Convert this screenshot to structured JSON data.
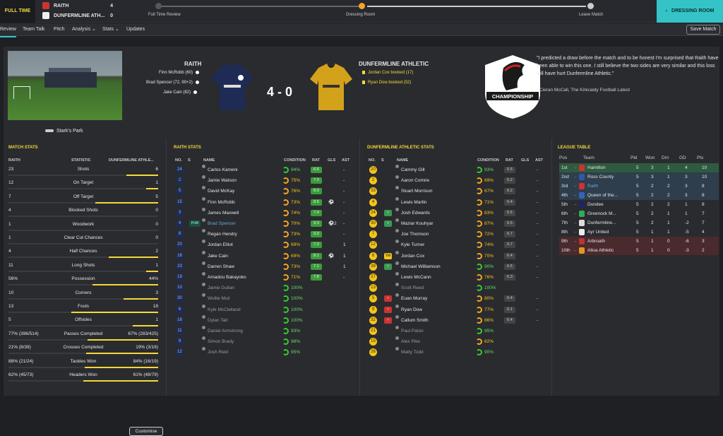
{
  "topbar": {
    "status": "FULL TIME",
    "home": {
      "name": "RAITH",
      "score": "4"
    },
    "away": {
      "name": "DUNFERMLINE ATH...",
      "score": "0"
    },
    "stages": [
      "Full Time Review",
      "Dressing Room",
      "Leave Match"
    ],
    "current_stage": "DRESSING ROOM"
  },
  "nav": {
    "items": [
      "Review",
      "Team Talk",
      "Pitch",
      "Analysis ⌄",
      "Stats ⌄",
      "Updates"
    ],
    "save": "Save Match"
  },
  "match": {
    "stadium": "Stark's Park",
    "home_team": "RAITH",
    "away_team": "DUNFERMLINE ATHLETIC",
    "score": "4 - 0",
    "home_events": [
      "Finn McRobb (60)",
      "Brad Spencer (72, 90+2)",
      "Jake Cain (82)"
    ],
    "away_events": [
      "Jordan Cox booked (17)",
      "Ryan Dow booked (52)"
    ],
    "logo_text": "CHAMPIONSHIP",
    "quote": "\"I predicted a draw before the match and to be honest I'm surprised that Raith have been able to win this one. I still believe the two sides are very similar and this loss will have hurt Dunfermline Athletic.\"",
    "quote_source": "- Cieran McCall, The Kirkcaldy Football Latest"
  },
  "match_stats": {
    "title": "MATCH STATS",
    "headers": [
      "RAITH",
      "STATISTIC",
      "DUNFERMLINE ATHLE..."
    ],
    "rows": [
      {
        "home": "23",
        "stat": "Shots",
        "away": "6",
        "hp": 0.79
      },
      {
        "home": "12",
        "stat": "On Target",
        "away": "1",
        "hp": 0.92
      },
      {
        "home": "7",
        "stat": "Off Target",
        "away": "5",
        "hp": 0.58
      },
      {
        "home": "4",
        "stat": "Blocked Shots",
        "away": "0",
        "hp": 1.0
      },
      {
        "home": "1",
        "stat": "Woodwork",
        "away": "0",
        "hp": 1.0
      },
      {
        "home": "1",
        "stat": "Clear Cut Chances",
        "away": "0",
        "hp": 1.0
      },
      {
        "home": "4",
        "stat": "Half Chances",
        "away": "2",
        "hp": 0.67
      },
      {
        "home": "11",
        "stat": "Long Shots",
        "away": "1",
        "hp": 0.92
      },
      {
        "home": "56%",
        "stat": "Possession",
        "away": "44%",
        "hp": 0.56
      },
      {
        "home": "10",
        "stat": "Corners",
        "away": "3",
        "hp": 0.77
      },
      {
        "home": "13",
        "stat": "Fouls",
        "away": "18",
        "hp": 0.42
      },
      {
        "home": "5",
        "stat": "Offsides",
        "away": "1",
        "hp": 0.83
      },
      {
        "home": "77% (396/514)",
        "stat": "Passes Completed",
        "away": "67% (283/425)",
        "hp": 0.53
      },
      {
        "home": "21% (8/39)",
        "stat": "Crosses Completed",
        "away": "19% (3/16)",
        "hp": 0.52
      },
      {
        "home": "88% (21/24)",
        "stat": "Tackles Won",
        "away": "84% (16/19)",
        "hp": 0.51
      },
      {
        "home": "62% (45/73)",
        "stat": "Headers Won",
        "away": "61% (48/79)",
        "hp": 0.5
      }
    ],
    "customise": "Customise"
  },
  "raith_stats": {
    "title": "RAITH STATS",
    "headers": [
      "NO.",
      "S",
      "NAME",
      "CONDITION",
      "RAT",
      "GLS",
      "AST"
    ],
    "players": [
      {
        "no": "24",
        "name": "Carlos Kameni",
        "cond": "94%",
        "rat": "6.6",
        "gls": "",
        "ast": "-",
        "hi": false
      },
      {
        "no": "2",
        "name": "Jamie Watson",
        "cond": "75%",
        "rat": "7.3",
        "gls": "",
        "ast": "-",
        "hi": true
      },
      {
        "no": "5",
        "name": "David McKay",
        "cond": "76%",
        "rat": "8.0",
        "gls": "",
        "ast": "-",
        "hi": true
      },
      {
        "no": "15",
        "name": "Finn McRobb",
        "cond": "73%",
        "rat": "8.5",
        "gls": "⚽",
        "ast": "-",
        "hi": true
      },
      {
        "no": "3",
        "name": "James Maxwell",
        "cond": "74%",
        "rat": "7.4",
        "gls": "",
        "ast": "-",
        "hi": true
      },
      {
        "no": "4",
        "name": "Brad Spencer",
        "cond": "70%",
        "rat": "9.3",
        "gls": "⚽2",
        "ast": "-",
        "hi": true,
        "pom": "PoM"
      },
      {
        "no": "8",
        "name": "Regan Hendry",
        "cond": "73%",
        "rat": "9.0",
        "gls": "",
        "ast": "-",
        "hi": true
      },
      {
        "no": "20",
        "name": "Jordan Elliot",
        "cond": "69%",
        "rat": "7.3",
        "gls": "",
        "ast": "1",
        "hi": true
      },
      {
        "no": "16",
        "name": "Jake Cain",
        "cond": "69%",
        "rat": "8.1",
        "gls": "⚽",
        "ast": "1",
        "hi": true
      },
      {
        "no": "23",
        "name": "Darren Shaw",
        "cond": "73%",
        "rat": "7.1",
        "gls": "",
        "ast": "1",
        "hi": true
      },
      {
        "no": "19",
        "name": "Amadou Bakayoko",
        "cond": "71%",
        "rat": "7.8",
        "gls": "",
        "ast": "-",
        "hi": true
      },
      {
        "no": "10",
        "name": "Jamie Gullan",
        "cond": "100%",
        "rat": "",
        "gls": "",
        "ast": "",
        "hi": false,
        "bench": true
      },
      {
        "no": "30",
        "name": "Wullie Muir",
        "cond": "100%",
        "rat": "",
        "gls": "",
        "ast": "",
        "hi": false,
        "bench": true
      },
      {
        "no": "6",
        "name": "Kyle McClelland",
        "cond": "100%",
        "rat": "",
        "gls": "",
        "ast": "",
        "hi": false,
        "bench": true
      },
      {
        "no": "18",
        "name": "Dylan Tait",
        "cond": "100%",
        "rat": "",
        "gls": "",
        "ast": "",
        "hi": false,
        "bench": true
      },
      {
        "no": "11",
        "name": "Daniel Armstrong",
        "cond": "93%",
        "rat": "",
        "gls": "",
        "ast": "",
        "hi": false,
        "bench": true
      },
      {
        "no": "9",
        "name": "Simon Brady",
        "cond": "98%",
        "rat": "",
        "gls": "",
        "ast": "",
        "hi": false,
        "bench": true
      },
      {
        "no": "12",
        "name": "Josh Reid",
        "cond": "95%",
        "rat": "",
        "gls": "",
        "ast": "",
        "hi": false,
        "bench": true
      }
    ]
  },
  "dunf_stats": {
    "title": "DUNFERMLINE ATHLETIC STATS",
    "headers": [
      "NO.",
      "S",
      "NAME",
      "CONDITION",
      "RAT",
      "GLS",
      "AST"
    ],
    "players": [
      {
        "no": "20",
        "name": "Cammy Gill",
        "cond": "93%",
        "rat": "6.5",
        "ast": "-",
        "sub": ""
      },
      {
        "no": "2",
        "name": "Aaron Comrie",
        "cond": "69%",
        "rat": "6.2",
        "ast": "-",
        "sub": ""
      },
      {
        "no": "33",
        "name": "Stuart Morrison",
        "cond": "67%",
        "rat": "6.2",
        "ast": "-",
        "sub": ""
      },
      {
        "no": "4",
        "name": "Lewis Martin",
        "cond": "71%",
        "rat": "6.4",
        "ast": "-",
        "sub": ""
      },
      {
        "no": "24",
        "name": "Josh Edwards",
        "cond": "83%",
        "rat": "6.5",
        "ast": "-",
        "sub": "in"
      },
      {
        "no": "30",
        "name": "Maziar Kouhyar",
        "cond": "87%",
        "rat": "6.5",
        "ast": "-",
        "sub": "in"
      },
      {
        "no": "7",
        "name": "Joe Thomson",
        "cond": "72%",
        "rat": "6.7",
        "ast": "-",
        "sub": ""
      },
      {
        "no": "12",
        "name": "Kyle Turner",
        "cond": "74%",
        "rat": "6.7",
        "ast": "-",
        "sub": ""
      },
      {
        "no": "6",
        "name": "Jordan Cox",
        "cond": "70%",
        "rat": "6.4",
        "ast": "-",
        "sub": "yel"
      },
      {
        "no": "39",
        "name": "Michael Williamson",
        "cond": "90%",
        "rat": "6.5",
        "ast": "-",
        "sub": "in"
      },
      {
        "no": "27",
        "name": "Lewis McCann",
        "cond": "76%",
        "rat": "6.3",
        "ast": "-",
        "sub": ""
      },
      {
        "no": "13",
        "name": "Scott Reed",
        "cond": "100%",
        "rat": "",
        "ast": "",
        "sub": "",
        "bench": true
      },
      {
        "no": "5",
        "name": "Euan Murray",
        "cond": "80%",
        "rat": "6.4",
        "ast": "-",
        "sub": "out"
      },
      {
        "no": "9",
        "name": "Ryan Dow",
        "cond": "77%",
        "rat": "6.1",
        "ast": "-",
        "sub": "out"
      },
      {
        "no": "32",
        "name": "Callum Smith",
        "cond": "86%",
        "rat": "6.4",
        "ast": "-",
        "sub": "out"
      },
      {
        "no": "21",
        "name": "Paul Paton",
        "cond": "95%",
        "rat": "",
        "ast": "",
        "sub": "",
        "bench": true
      },
      {
        "no": "15",
        "name": "Alex Pike",
        "cond": "82%",
        "rat": "",
        "ast": "",
        "sub": "",
        "bench": true
      },
      {
        "no": "26",
        "name": "Matty Todd",
        "cond": "90%",
        "rat": "",
        "ast": "",
        "sub": "",
        "bench": true
      }
    ]
  },
  "league": {
    "title": "LEAGUE TABLE",
    "headers": [
      "Pos",
      "Team",
      "Pld",
      "Won",
      "Drn",
      "GD",
      "Pts"
    ],
    "rows": [
      {
        "pos": "1st",
        "team": "Hamilton",
        "pld": "5",
        "won": "3",
        "drn": "1",
        "gd": "4",
        "pts": "10",
        "bg": "#2f5a3f",
        "crest": "#c33"
      },
      {
        "pos": "2nd",
        "team": "Ross County",
        "pld": "5",
        "won": "3",
        "drn": "1",
        "gd": "3",
        "pts": "10",
        "bg": "#2e3e4c",
        "crest": "#35a"
      },
      {
        "pos": "3rd",
        "team": "Raith",
        "pld": "5",
        "won": "2",
        "drn": "2",
        "gd": "3",
        "pts": "8",
        "bg": "#2e3e4c",
        "crest": "#c33",
        "hl": true
      },
      {
        "pos": "4th",
        "team": "Queen of the...",
        "pld": "5",
        "won": "2",
        "drn": "2",
        "gd": "3",
        "pts": "8",
        "bg": "#2e3e4c",
        "crest": "#36b"
      },
      {
        "pos": "5th",
        "team": "Dundee",
        "pld": "5",
        "won": "2",
        "drn": "2",
        "gd": "1",
        "pts": "8",
        "bg": "",
        "crest": "#226"
      },
      {
        "pos": "6th",
        "team": "Greenock M...",
        "pld": "5",
        "won": "2",
        "drn": "1",
        "gd": "1",
        "pts": "7",
        "bg": "",
        "crest": "#3a5"
      },
      {
        "pos": "7th",
        "team": "Dunfermline...",
        "pld": "5",
        "won": "2",
        "drn": "1",
        "gd": "-2",
        "pts": "7",
        "bg": "",
        "crest": "#ddd"
      },
      {
        "pos": "8th",
        "team": "Ayr United",
        "pld": "5",
        "won": "1",
        "drn": "1",
        "gd": "-5",
        "pts": "4",
        "bg": "",
        "crest": "#eee"
      },
      {
        "pos": "9th",
        "team": "Arbroath",
        "pld": "5",
        "won": "1",
        "drn": "0",
        "gd": "-6",
        "pts": "3",
        "bg": "#4a2a2c",
        "crest": "#b33"
      },
      {
        "pos": "10th",
        "team": "Alloa Athletic",
        "pld": "5",
        "won": "1",
        "drn": "0",
        "gd": "-3",
        "pts": "2",
        "bg": "#4a2a2c",
        "crest": "#d92"
      }
    ]
  },
  "colors": {
    "accent": "#f5d83a",
    "teal": "#34c4c7",
    "rating_green": "#3c9a3c"
  }
}
